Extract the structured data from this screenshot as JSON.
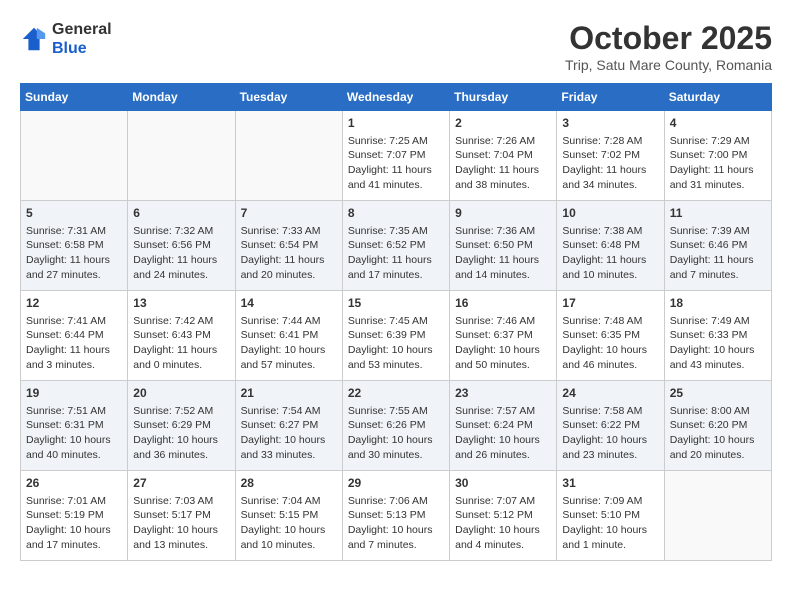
{
  "header": {
    "logo_line1": "General",
    "logo_line2": "Blue",
    "month": "October 2025",
    "location": "Trip, Satu Mare County, Romania"
  },
  "weekdays": [
    "Sunday",
    "Monday",
    "Tuesday",
    "Wednesday",
    "Thursday",
    "Friday",
    "Saturday"
  ],
  "weeks": [
    [
      {
        "day": "",
        "info": ""
      },
      {
        "day": "",
        "info": ""
      },
      {
        "day": "",
        "info": ""
      },
      {
        "day": "1",
        "info": "Sunrise: 7:25 AM\nSunset: 7:07 PM\nDaylight: 11 hours and 41 minutes."
      },
      {
        "day": "2",
        "info": "Sunrise: 7:26 AM\nSunset: 7:04 PM\nDaylight: 11 hours and 38 minutes."
      },
      {
        "day": "3",
        "info": "Sunrise: 7:28 AM\nSunset: 7:02 PM\nDaylight: 11 hours and 34 minutes."
      },
      {
        "day": "4",
        "info": "Sunrise: 7:29 AM\nSunset: 7:00 PM\nDaylight: 11 hours and 31 minutes."
      }
    ],
    [
      {
        "day": "5",
        "info": "Sunrise: 7:31 AM\nSunset: 6:58 PM\nDaylight: 11 hours and 27 minutes."
      },
      {
        "day": "6",
        "info": "Sunrise: 7:32 AM\nSunset: 6:56 PM\nDaylight: 11 hours and 24 minutes."
      },
      {
        "day": "7",
        "info": "Sunrise: 7:33 AM\nSunset: 6:54 PM\nDaylight: 11 hours and 20 minutes."
      },
      {
        "day": "8",
        "info": "Sunrise: 7:35 AM\nSunset: 6:52 PM\nDaylight: 11 hours and 17 minutes."
      },
      {
        "day": "9",
        "info": "Sunrise: 7:36 AM\nSunset: 6:50 PM\nDaylight: 11 hours and 14 minutes."
      },
      {
        "day": "10",
        "info": "Sunrise: 7:38 AM\nSunset: 6:48 PM\nDaylight: 11 hours and 10 minutes."
      },
      {
        "day": "11",
        "info": "Sunrise: 7:39 AM\nSunset: 6:46 PM\nDaylight: 11 hours and 7 minutes."
      }
    ],
    [
      {
        "day": "12",
        "info": "Sunrise: 7:41 AM\nSunset: 6:44 PM\nDaylight: 11 hours and 3 minutes."
      },
      {
        "day": "13",
        "info": "Sunrise: 7:42 AM\nSunset: 6:43 PM\nDaylight: 11 hours and 0 minutes."
      },
      {
        "day": "14",
        "info": "Sunrise: 7:44 AM\nSunset: 6:41 PM\nDaylight: 10 hours and 57 minutes."
      },
      {
        "day": "15",
        "info": "Sunrise: 7:45 AM\nSunset: 6:39 PM\nDaylight: 10 hours and 53 minutes."
      },
      {
        "day": "16",
        "info": "Sunrise: 7:46 AM\nSunset: 6:37 PM\nDaylight: 10 hours and 50 minutes."
      },
      {
        "day": "17",
        "info": "Sunrise: 7:48 AM\nSunset: 6:35 PM\nDaylight: 10 hours and 46 minutes."
      },
      {
        "day": "18",
        "info": "Sunrise: 7:49 AM\nSunset: 6:33 PM\nDaylight: 10 hours and 43 minutes."
      }
    ],
    [
      {
        "day": "19",
        "info": "Sunrise: 7:51 AM\nSunset: 6:31 PM\nDaylight: 10 hours and 40 minutes."
      },
      {
        "day": "20",
        "info": "Sunrise: 7:52 AM\nSunset: 6:29 PM\nDaylight: 10 hours and 36 minutes."
      },
      {
        "day": "21",
        "info": "Sunrise: 7:54 AM\nSunset: 6:27 PM\nDaylight: 10 hours and 33 minutes."
      },
      {
        "day": "22",
        "info": "Sunrise: 7:55 AM\nSunset: 6:26 PM\nDaylight: 10 hours and 30 minutes."
      },
      {
        "day": "23",
        "info": "Sunrise: 7:57 AM\nSunset: 6:24 PM\nDaylight: 10 hours and 26 minutes."
      },
      {
        "day": "24",
        "info": "Sunrise: 7:58 AM\nSunset: 6:22 PM\nDaylight: 10 hours and 23 minutes."
      },
      {
        "day": "25",
        "info": "Sunrise: 8:00 AM\nSunset: 6:20 PM\nDaylight: 10 hours and 20 minutes."
      }
    ],
    [
      {
        "day": "26",
        "info": "Sunrise: 7:01 AM\nSunset: 5:19 PM\nDaylight: 10 hours and 17 minutes."
      },
      {
        "day": "27",
        "info": "Sunrise: 7:03 AM\nSunset: 5:17 PM\nDaylight: 10 hours and 13 minutes."
      },
      {
        "day": "28",
        "info": "Sunrise: 7:04 AM\nSunset: 5:15 PM\nDaylight: 10 hours and 10 minutes."
      },
      {
        "day": "29",
        "info": "Sunrise: 7:06 AM\nSunset: 5:13 PM\nDaylight: 10 hours and 7 minutes."
      },
      {
        "day": "30",
        "info": "Sunrise: 7:07 AM\nSunset: 5:12 PM\nDaylight: 10 hours and 4 minutes."
      },
      {
        "day": "31",
        "info": "Sunrise: 7:09 AM\nSunset: 5:10 PM\nDaylight: 10 hours and 1 minute."
      },
      {
        "day": "",
        "info": ""
      }
    ]
  ]
}
